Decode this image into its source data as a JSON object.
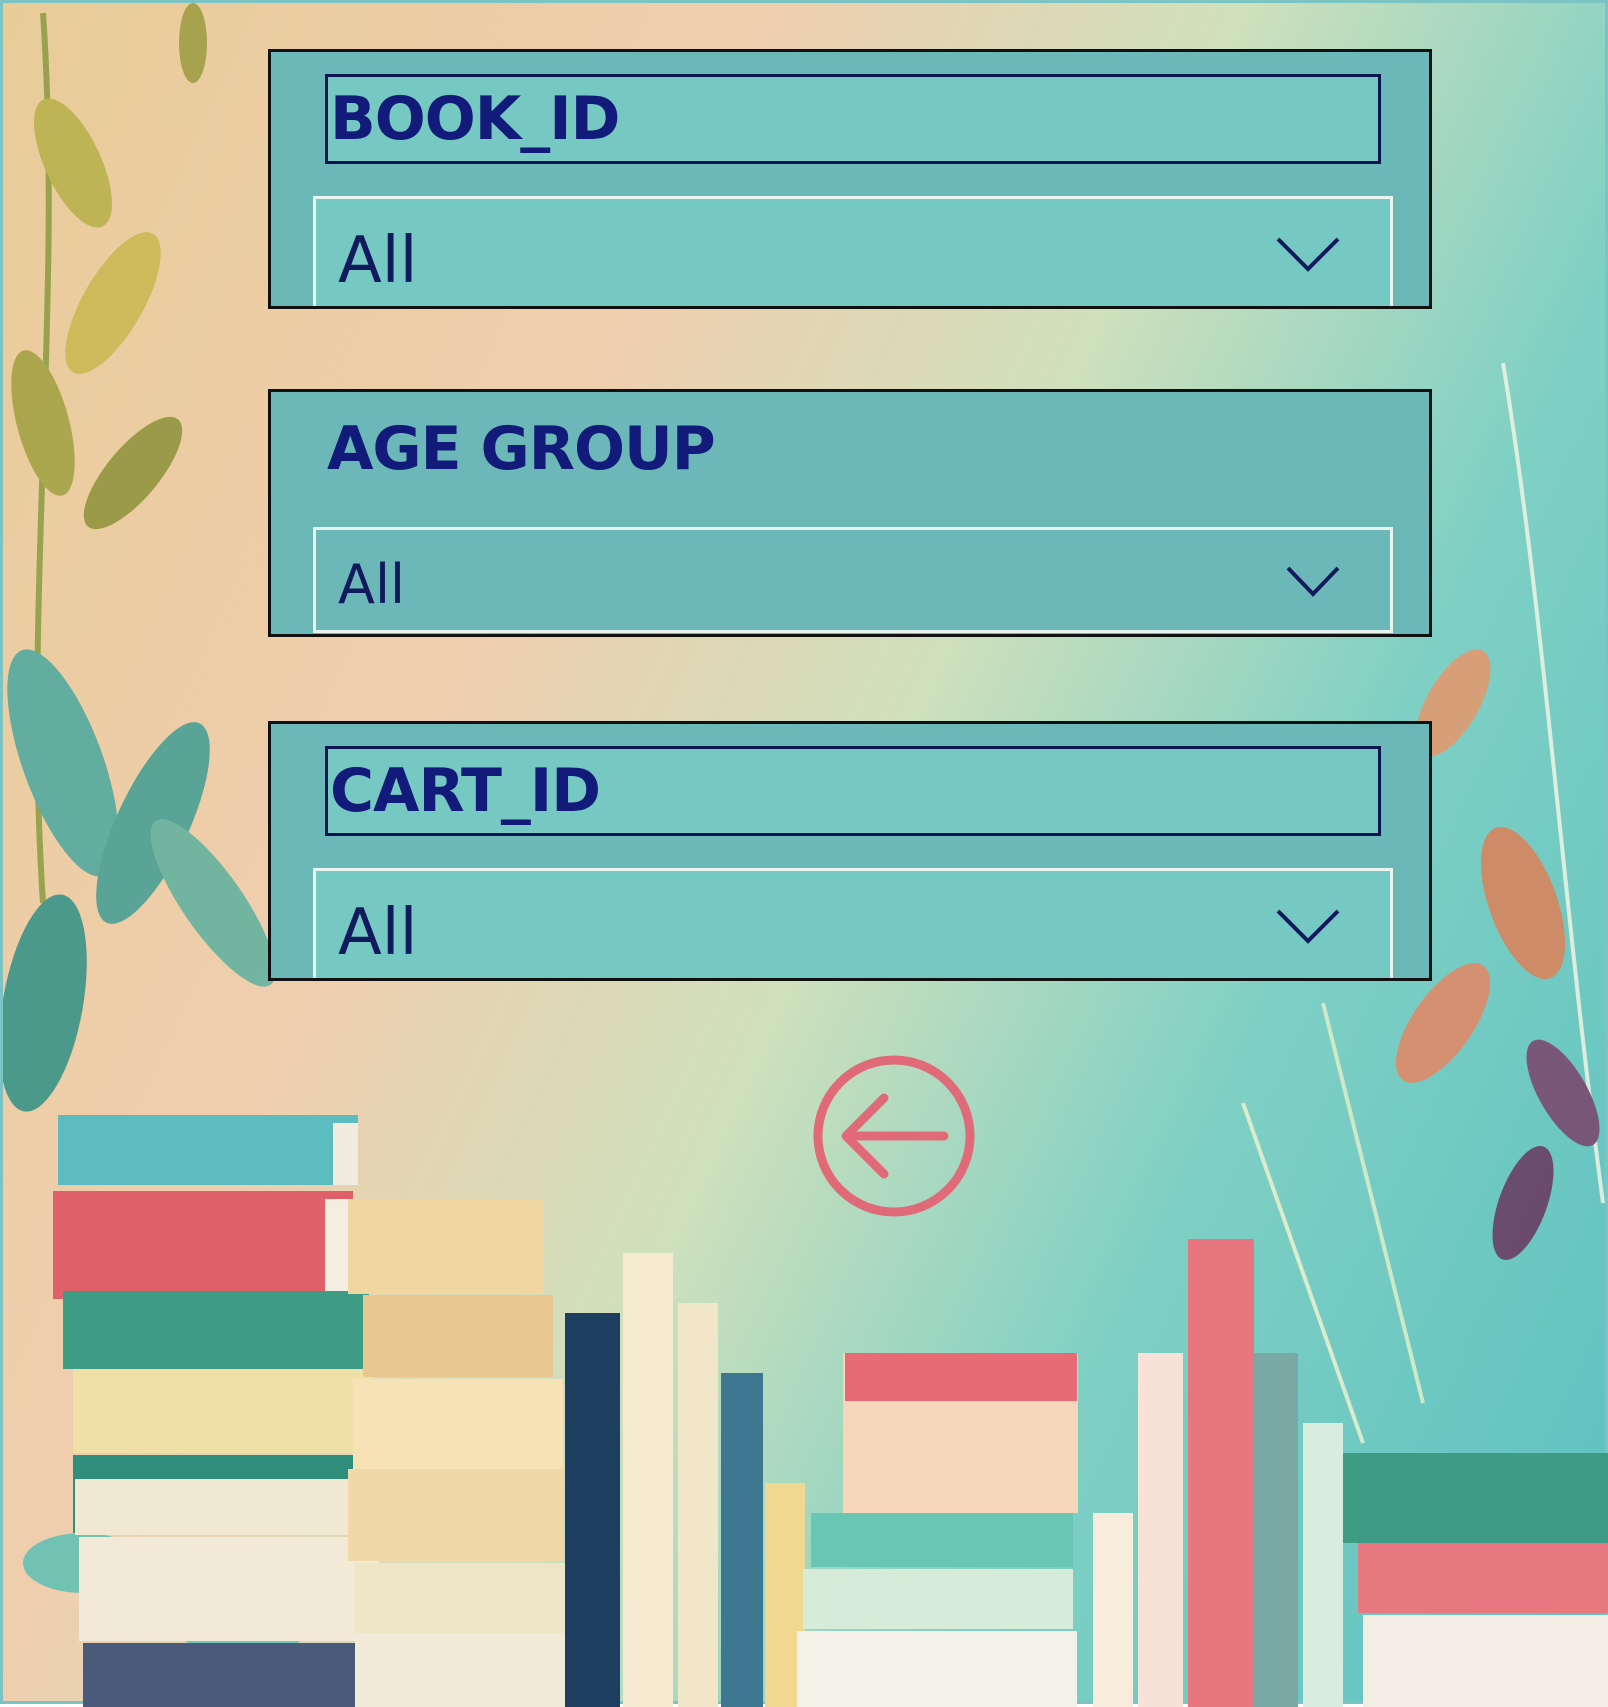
{
  "slicers": [
    {
      "title": "BOOK_ID",
      "value": "All"
    },
    {
      "title": "AGE GROUP",
      "value": "All"
    },
    {
      "title": "CART_ID",
      "value": "All"
    }
  ],
  "icons": {
    "dropdown": "chevron-down-icon",
    "back": "back-arrow-circle-icon"
  },
  "colors": {
    "slicer_bg": "#6cb8b8",
    "title_text": "#121a7a",
    "back_icon": "#e06a78"
  }
}
